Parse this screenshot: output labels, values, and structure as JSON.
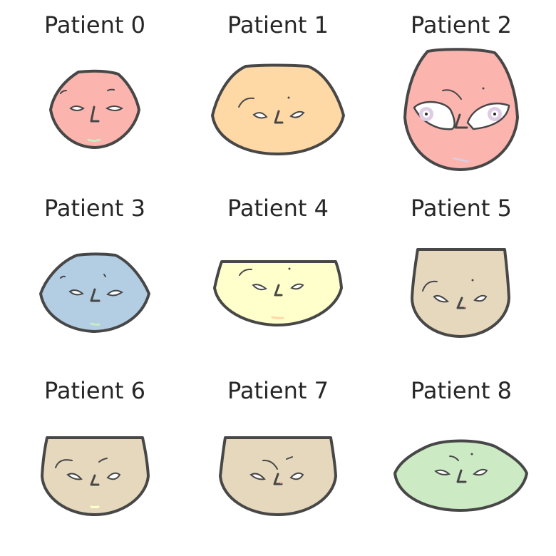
{
  "colors": {
    "outline": "#474747",
    "text": "#262626",
    "background": "#ffffff"
  },
  "faces": [
    {
      "label": "Patient 0",
      "skin": "#fbb4ae",
      "shape": "egg",
      "mouth_color": "#ccebc5"
    },
    {
      "label": "Patient 1",
      "skin": "#fed9a6",
      "shape": "dome",
      "mouth_color": null
    },
    {
      "label": "Patient 2",
      "skin": "#fbb4ae",
      "shape": "tall-egg",
      "mouth_color": "#decbe4",
      "big_eyes": true
    },
    {
      "label": "Patient 3",
      "skin": "#b3cde3",
      "shape": "dome",
      "mouth_color": "#ccebc5"
    },
    {
      "label": "Patient 4",
      "skin": "#ffffcc",
      "shape": "bowl",
      "mouth_color": "#fed9a6"
    },
    {
      "label": "Patient 5",
      "skin": "#e5d8bd",
      "shape": "cup",
      "mouth_color": null
    },
    {
      "label": "Patient 6",
      "skin": "#e5d8bd",
      "shape": "cup",
      "mouth_color": "#ffffcc"
    },
    {
      "label": "Patient 7",
      "skin": "#e5d8bd",
      "shape": "cup",
      "mouth_color": null
    },
    {
      "label": "Patient 8",
      "skin": "#ccebc5",
      "shape": "oval",
      "mouth_color": null
    }
  ]
}
